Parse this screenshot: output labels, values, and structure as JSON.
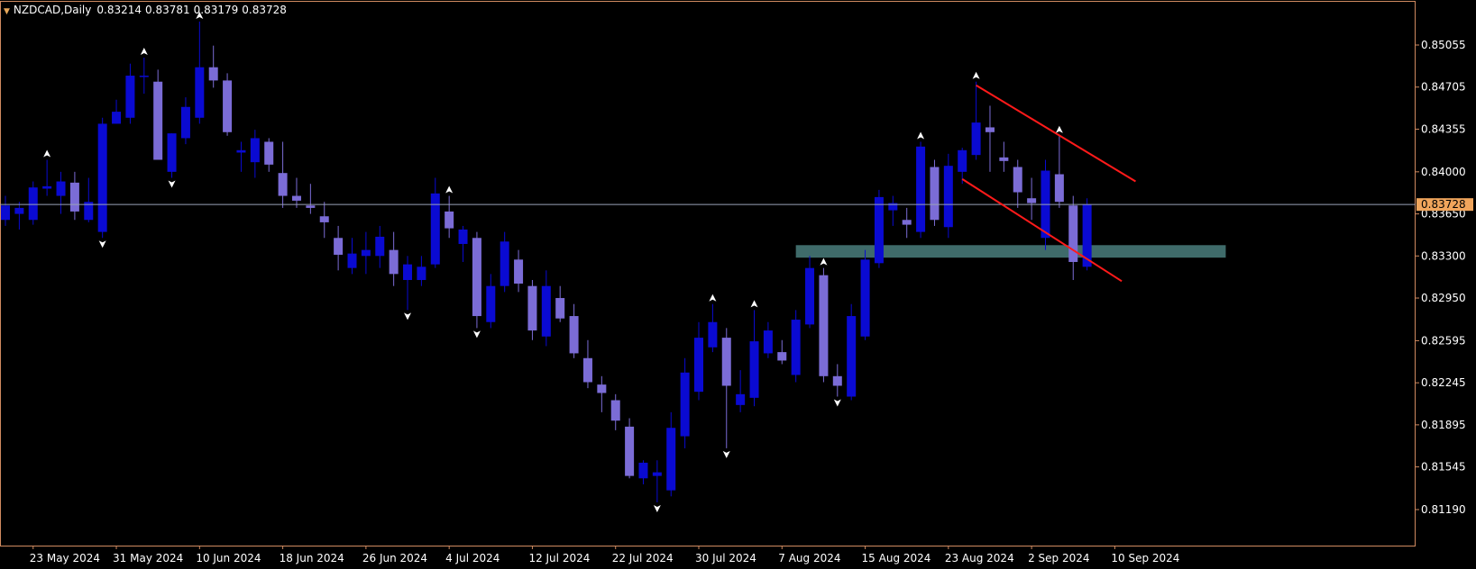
{
  "header": {
    "symbol": "NZDCAD,Daily",
    "ohlc": [
      "0.83214",
      "0.83781",
      "0.83179",
      "0.83728"
    ]
  },
  "colors": {
    "background": "#000000",
    "frame": "#d08a60",
    "axis_text": "#ffffff",
    "bull": "#0a0ad2",
    "bear": "#7b6cd6",
    "current_price_line": "#9aa3b8",
    "current_price_label_bg": "#f0a55c",
    "zone": "#3f6b6a",
    "trendline": "#ff1a1a",
    "fractal": "#ffffff"
  },
  "chart_data": {
    "type": "candlestick",
    "symbol": "NZDCAD",
    "timeframe": "Daily",
    "ylim": [
      0.81,
      0.8535
    ],
    "y_ticks": [
      "0.85055",
      "0.84705",
      "0.84355",
      "0.84000",
      "0.83650",
      "0.83300",
      "0.82950",
      "0.82595",
      "0.82245",
      "0.81895",
      "0.81545",
      "0.81190"
    ],
    "x_ticks": [
      {
        "index": 2,
        "label": "23 May 2024"
      },
      {
        "index": 8,
        "label": "31 May 2024"
      },
      {
        "index": 14,
        "label": "10 Jun 2024"
      },
      {
        "index": 20,
        "label": "18 Jun 2024"
      },
      {
        "index": 26,
        "label": "26 Jun 2024"
      },
      {
        "index": 32,
        "label": "4 Jul 2024"
      },
      {
        "index": 38,
        "label": "12 Jul 2024"
      },
      {
        "index": 44,
        "label": "22 Jul 2024"
      },
      {
        "index": 50,
        "label": "30 Jul 2024"
      },
      {
        "index": 56,
        "label": "7 Aug 2024"
      },
      {
        "index": 62,
        "label": "15 Aug 2024"
      },
      {
        "index": 68,
        "label": "23 Aug 2024"
      },
      {
        "index": 74,
        "label": "2 Sep 2024"
      },
      {
        "index": 80,
        "label": "10 Sep 2024"
      }
    ],
    "current_price": "0.83728",
    "candles": [
      {
        "o": 0.836,
        "h": 0.838,
        "l": 0.8355,
        "c": 0.8372
      },
      {
        "o": 0.8365,
        "h": 0.8375,
        "l": 0.8352,
        "c": 0.837
      },
      {
        "o": 0.836,
        "h": 0.8392,
        "l": 0.8356,
        "c": 0.8387
      },
      {
        "o": 0.8386,
        "h": 0.841,
        "l": 0.838,
        "c": 0.8388
      },
      {
        "o": 0.838,
        "h": 0.84,
        "l": 0.8365,
        "c": 0.8392
      },
      {
        "o": 0.8391,
        "h": 0.84,
        "l": 0.836,
        "c": 0.8367
      },
      {
        "o": 0.836,
        "h": 0.8395,
        "l": 0.8358,
        "c": 0.8375
      },
      {
        "o": 0.835,
        "h": 0.8445,
        "l": 0.8345,
        "c": 0.844
      },
      {
        "o": 0.844,
        "h": 0.846,
        "l": 0.844,
        "c": 0.845
      },
      {
        "o": 0.8445,
        "h": 0.849,
        "l": 0.844,
        "c": 0.848
      },
      {
        "o": 0.848,
        "h": 0.8495,
        "l": 0.8465,
        "c": 0.848
      },
      {
        "o": 0.8475,
        "h": 0.8485,
        "l": 0.841,
        "c": 0.841
      },
      {
        "o": 0.84,
        "h": 0.8432,
        "l": 0.8395,
        "c": 0.8432
      },
      {
        "o": 0.8428,
        "h": 0.8462,
        "l": 0.8423,
        "c": 0.8454
      },
      {
        "o": 0.8445,
        "h": 0.8525,
        "l": 0.844,
        "c": 0.8487
      },
      {
        "o": 0.8487,
        "h": 0.8505,
        "l": 0.847,
        "c": 0.8476
      },
      {
        "o": 0.8476,
        "h": 0.8482,
        "l": 0.843,
        "c": 0.8433
      },
      {
        "o": 0.8416,
        "h": 0.8425,
        "l": 0.84,
        "c": 0.8418
      },
      {
        "o": 0.8408,
        "h": 0.8435,
        "l": 0.8395,
        "c": 0.8428
      },
      {
        "o": 0.8425,
        "h": 0.8428,
        "l": 0.84,
        "c": 0.8406
      },
      {
        "o": 0.8399,
        "h": 0.8425,
        "l": 0.837,
        "c": 0.838
      },
      {
        "o": 0.838,
        "h": 0.8395,
        "l": 0.837,
        "c": 0.8376
      },
      {
        "o": 0.8372,
        "h": 0.839,
        "l": 0.8365,
        "c": 0.837
      },
      {
        "o": 0.8363,
        "h": 0.8375,
        "l": 0.8345,
        "c": 0.8358
      },
      {
        "o": 0.8345,
        "h": 0.8355,
        "l": 0.8318,
        "c": 0.8331
      },
      {
        "o": 0.832,
        "h": 0.8345,
        "l": 0.8315,
        "c": 0.8332
      },
      {
        "o": 0.833,
        "h": 0.835,
        "l": 0.8315,
        "c": 0.8335
      },
      {
        "o": 0.833,
        "h": 0.8355,
        "l": 0.832,
        "c": 0.8346
      },
      {
        "o": 0.8335,
        "h": 0.835,
        "l": 0.8305,
        "c": 0.8315
      },
      {
        "o": 0.831,
        "h": 0.833,
        "l": 0.8285,
        "c": 0.8323
      },
      {
        "o": 0.831,
        "h": 0.833,
        "l": 0.8305,
        "c": 0.8321
      },
      {
        "o": 0.8323,
        "h": 0.8395,
        "l": 0.832,
        "c": 0.8382
      },
      {
        "o": 0.8367,
        "h": 0.838,
        "l": 0.8345,
        "c": 0.8353
      },
      {
        "o": 0.834,
        "h": 0.8355,
        "l": 0.8325,
        "c": 0.8352
      },
      {
        "o": 0.8345,
        "h": 0.835,
        "l": 0.827,
        "c": 0.828
      },
      {
        "o": 0.8275,
        "h": 0.8315,
        "l": 0.827,
        "c": 0.8305
      },
      {
        "o": 0.8305,
        "h": 0.835,
        "l": 0.83,
        "c": 0.8342
      },
      {
        "o": 0.8327,
        "h": 0.8335,
        "l": 0.83,
        "c": 0.8307
      },
      {
        "o": 0.8305,
        "h": 0.831,
        "l": 0.826,
        "c": 0.8268
      },
      {
        "o": 0.8263,
        "h": 0.8318,
        "l": 0.8255,
        "c": 0.8305
      },
      {
        "o": 0.8295,
        "h": 0.8305,
        "l": 0.8275,
        "c": 0.8278
      },
      {
        "o": 0.828,
        "h": 0.829,
        "l": 0.8245,
        "c": 0.8249
      },
      {
        "o": 0.8245,
        "h": 0.826,
        "l": 0.822,
        "c": 0.8225
      },
      {
        "o": 0.8223,
        "h": 0.823,
        "l": 0.82,
        "c": 0.8216
      },
      {
        "o": 0.821,
        "h": 0.8215,
        "l": 0.8185,
        "c": 0.8193
      },
      {
        "o": 0.8188,
        "h": 0.8195,
        "l": 0.8145,
        "c": 0.8147
      },
      {
        "o": 0.8145,
        "h": 0.816,
        "l": 0.814,
        "c": 0.8158
      },
      {
        "o": 0.8147,
        "h": 0.816,
        "l": 0.8125,
        "c": 0.815
      },
      {
        "o": 0.8135,
        "h": 0.82,
        "l": 0.813,
        "c": 0.8187
      },
      {
        "o": 0.818,
        "h": 0.8245,
        "l": 0.817,
        "c": 0.8233
      },
      {
        "o": 0.8217,
        "h": 0.8275,
        "l": 0.821,
        "c": 0.8262
      },
      {
        "o": 0.8254,
        "h": 0.829,
        "l": 0.825,
        "c": 0.8275
      },
      {
        "o": 0.8262,
        "h": 0.827,
        "l": 0.817,
        "c": 0.8222
      },
      {
        "o": 0.8206,
        "h": 0.8235,
        "l": 0.82,
        "c": 0.8215
      },
      {
        "o": 0.8212,
        "h": 0.8285,
        "l": 0.8205,
        "c": 0.8259
      },
      {
        "o": 0.8249,
        "h": 0.8275,
        "l": 0.8245,
        "c": 0.8268
      },
      {
        "o": 0.825,
        "h": 0.826,
        "l": 0.824,
        "c": 0.8243
      },
      {
        "o": 0.8231,
        "h": 0.8285,
        "l": 0.8225,
        "c": 0.8277
      },
      {
        "o": 0.8273,
        "h": 0.833,
        "l": 0.827,
        "c": 0.832
      },
      {
        "o": 0.8314,
        "h": 0.832,
        "l": 0.8225,
        "c": 0.823
      },
      {
        "o": 0.823,
        "h": 0.824,
        "l": 0.8213,
        "c": 0.8222
      },
      {
        "o": 0.8213,
        "h": 0.829,
        "l": 0.821,
        "c": 0.828
      },
      {
        "o": 0.8263,
        "h": 0.8335,
        "l": 0.826,
        "c": 0.8327
      },
      {
        "o": 0.8324,
        "h": 0.8385,
        "l": 0.832,
        "c": 0.8379
      },
      {
        "o": 0.8368,
        "h": 0.838,
        "l": 0.8355,
        "c": 0.8374
      },
      {
        "o": 0.836,
        "h": 0.837,
        "l": 0.8345,
        "c": 0.8356
      },
      {
        "o": 0.835,
        "h": 0.8425,
        "l": 0.8345,
        "c": 0.8421
      },
      {
        "o": 0.8404,
        "h": 0.841,
        "l": 0.8355,
        "c": 0.836
      },
      {
        "o": 0.8354,
        "h": 0.8415,
        "l": 0.8345,
        "c": 0.8405
      },
      {
        "o": 0.84,
        "h": 0.842,
        "l": 0.839,
        "c": 0.8418
      },
      {
        "o": 0.8414,
        "h": 0.8475,
        "l": 0.841,
        "c": 0.8441
      },
      {
        "o": 0.8437,
        "h": 0.8455,
        "l": 0.84,
        "c": 0.8433
      },
      {
        "o": 0.8412,
        "h": 0.8425,
        "l": 0.84,
        "c": 0.8409
      },
      {
        "o": 0.8404,
        "h": 0.841,
        "l": 0.837,
        "c": 0.8383
      },
      {
        "o": 0.8378,
        "h": 0.8395,
        "l": 0.836,
        "c": 0.8374
      },
      {
        "o": 0.8345,
        "h": 0.841,
        "l": 0.8335,
        "c": 0.8401
      },
      {
        "o": 0.8398,
        "h": 0.843,
        "l": 0.837,
        "c": 0.8375
      },
      {
        "o": 0.8372,
        "h": 0.838,
        "l": 0.831,
        "c": 0.8325
      },
      {
        "o": 0.8321,
        "h": 0.8378,
        "l": 0.8318,
        "c": 0.8373
      }
    ],
    "fractals": [
      {
        "index": 3,
        "dir": "up"
      },
      {
        "index": 7,
        "dir": "down"
      },
      {
        "index": 10,
        "dir": "up"
      },
      {
        "index": 12,
        "dir": "down"
      },
      {
        "index": 14,
        "dir": "up"
      },
      {
        "index": 29,
        "dir": "down"
      },
      {
        "index": 32,
        "dir": "up"
      },
      {
        "index": 34,
        "dir": "down"
      },
      {
        "index": 47,
        "dir": "down"
      },
      {
        "index": 51,
        "dir": "up"
      },
      {
        "index": 52,
        "dir": "down"
      },
      {
        "index": 54,
        "dir": "up"
      },
      {
        "index": 59,
        "dir": "up"
      },
      {
        "index": 60,
        "dir": "down"
      },
      {
        "index": 66,
        "dir": "up"
      },
      {
        "index": 70,
        "dir": "up"
      },
      {
        "index": 76,
        "dir": "up"
      }
    ],
    "zone": {
      "from_index": 57,
      "to_index": 88,
      "low": 0.83286,
      "high": 0.8339
    },
    "trendlines": [
      {
        "from": {
          "index": 70,
          "price": 0.8472
        },
        "to": {
          "index": 81.5,
          "price": 0.8392
        }
      },
      {
        "from": {
          "index": 69,
          "price": 0.8394
        },
        "to": {
          "index": 80.5,
          "price": 0.8309
        }
      }
    ]
  }
}
